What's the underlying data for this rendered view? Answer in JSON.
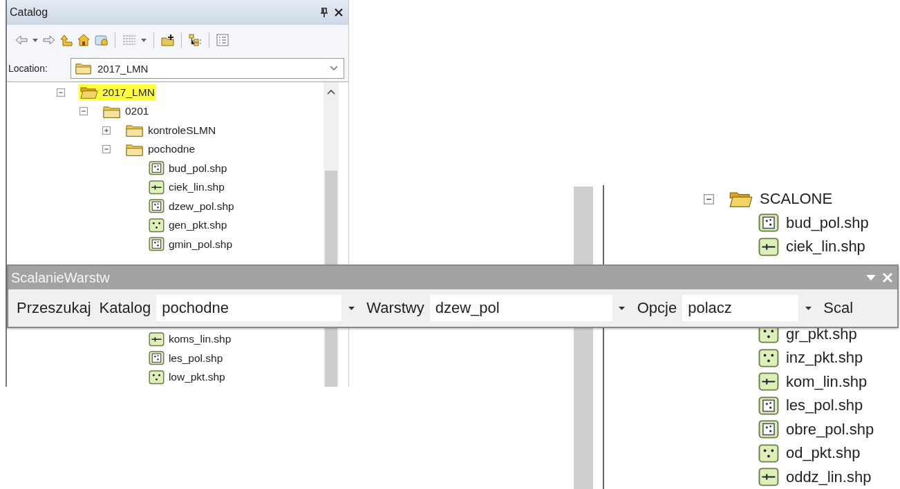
{
  "catalog": {
    "title": "Catalog",
    "location": {
      "label": "Location:",
      "value": "2017_LMN"
    },
    "tree": [
      {
        "name": "2017_LMN",
        "kind": "open-folder",
        "expanded": true,
        "selected": true,
        "children": [
          {
            "name": "0201",
            "kind": "folder",
            "expanded": true,
            "selected": false,
            "children": [
              {
                "name": "kontroleSLMN",
                "kind": "folder",
                "expanded": false,
                "selected": false
              },
              {
                "name": "pochodne",
                "kind": "folder",
                "expanded": true,
                "selected": false,
                "children": [
                  {
                    "name": "bud_pol.shp",
                    "kind": "polygon",
                    "selected": false
                  },
                  {
                    "name": "ciek_lin.shp",
                    "kind": "line",
                    "selected": false
                  },
                  {
                    "name": "dzew_pol.shp",
                    "kind": "polygon",
                    "selected": false
                  },
                  {
                    "name": "gen_pkt.shp",
                    "kind": "point",
                    "selected": false
                  },
                  {
                    "name": "gmin_pol.shp",
                    "kind": "polygon",
                    "selected": false
                  },
                  {
                    "name": "koms_lin.shp",
                    "kind": "line",
                    "selected": false
                  },
                  {
                    "name": "les_pol.shp",
                    "kind": "polygon",
                    "selected": false
                  },
                  {
                    "name": "low_pkt.shp",
                    "kind": "point",
                    "selected": false
                  }
                ]
              }
            ]
          }
        ]
      }
    ]
  },
  "merged_tree": [
    {
      "name": "SCALONE",
      "kind": "open-folder",
      "expanded": true,
      "selected": false,
      "children": [
        {
          "name": "bud_pol.shp",
          "kind": "polygon",
          "selected": false
        },
        {
          "name": "ciek_lin.shp",
          "kind": "line",
          "selected": false
        },
        {
          "name": "gr_pkt.shp",
          "kind": "point",
          "selected": false
        },
        {
          "name": "inz_pkt.shp",
          "kind": "point",
          "selected": false
        },
        {
          "name": "kom_lin.shp",
          "kind": "line",
          "selected": false
        },
        {
          "name": "les_pol.shp",
          "kind": "polygon",
          "selected": false
        },
        {
          "name": "obre_pol.shp",
          "kind": "polygon",
          "selected": false
        },
        {
          "name": "od_pkt.shp",
          "kind": "point",
          "selected": false
        },
        {
          "name": "oddz_lin.shp",
          "kind": "line",
          "selected": false
        }
      ]
    }
  ],
  "toolbar": {
    "title": "ScalanieWarstw",
    "search_button": "Przeszukaj",
    "catalog_label": "Katalog",
    "catalog_value": "pochodne",
    "layers_label": "Warstwy",
    "layers_value": "dzew_pol",
    "options_label": "Opcje",
    "options_value": "polacz",
    "merge_button": "Scal"
  }
}
